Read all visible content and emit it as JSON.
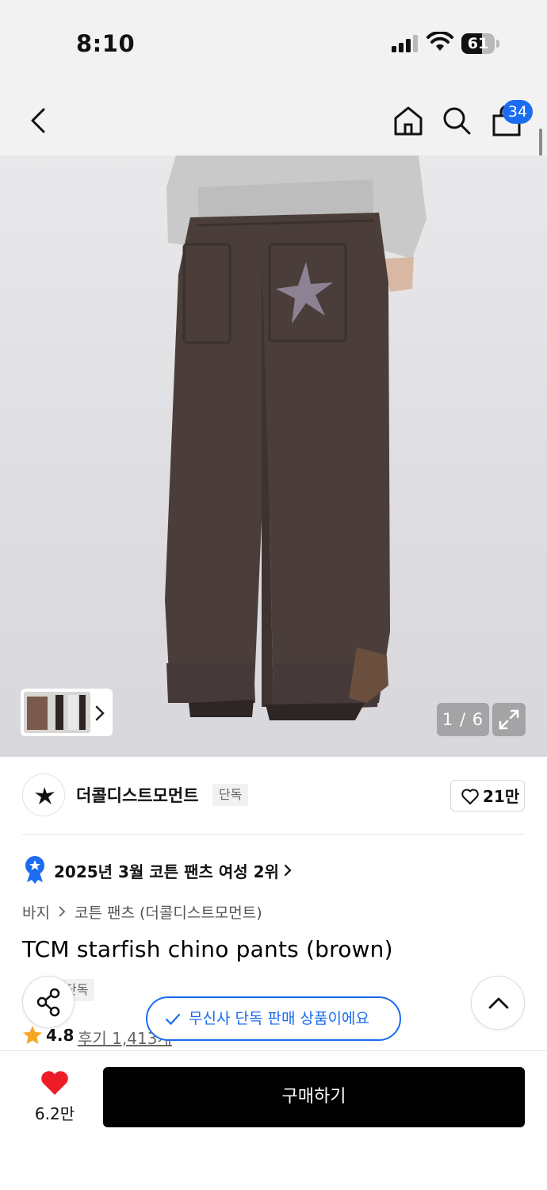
{
  "status_bar": {
    "time": "8:10",
    "battery": "61",
    "battery_level": 0.61
  },
  "nav": {
    "cart_count": "34"
  },
  "gallery": {
    "counter": "1 / 6"
  },
  "brand": {
    "name": "더콜디스트모먼트",
    "tag": "단독",
    "likes": "21만"
  },
  "ranking": {
    "text": "2025년 3월 코튼 팬츠 여성 2위"
  },
  "breadcrumb": {
    "category": "바지",
    "subcategory": "코튼 팬츠 (더콜디스트모먼트)"
  },
  "product": {
    "title": "TCM starfish chino pants (brown)",
    "exclusive_tag": "단독",
    "rating": "4.8",
    "reviews": "후기 1,413개"
  },
  "toast": {
    "text": "무신사 단독 판매 상품이에요"
  },
  "bottom_bar": {
    "like_count": "6.2만",
    "buy_label": "구매하기"
  },
  "colors": {
    "accent_blue": "#1a6cf0",
    "heart_red": "#ee1c27",
    "star_orange": "#f5a623",
    "buy_black": "#000000"
  }
}
